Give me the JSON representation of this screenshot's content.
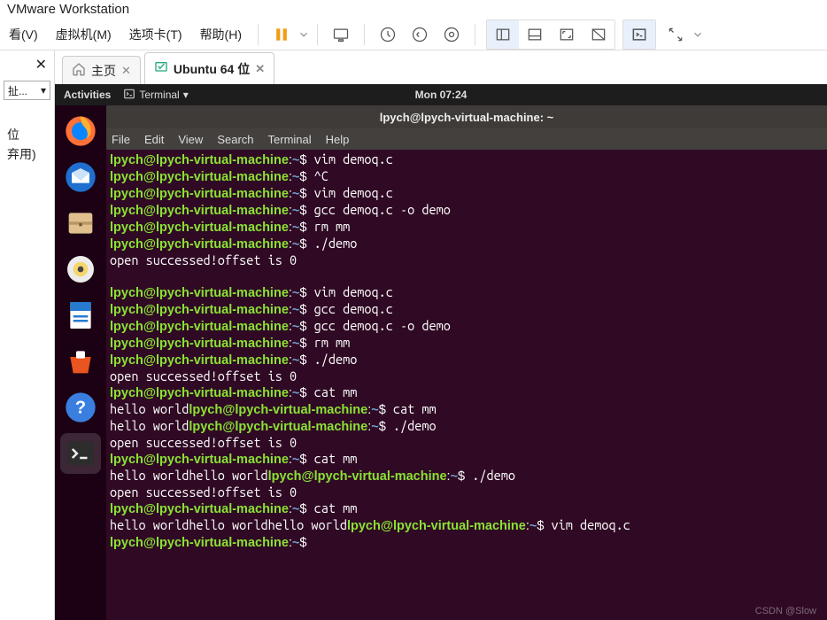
{
  "window": {
    "title": "VMware Workstation"
  },
  "menus": {
    "view": "看(V)",
    "vm": "虚拟机(M)",
    "tabs": "选项卡(T)",
    "help": "帮助(H)"
  },
  "left_panel": {
    "label1": "位",
    "label2": "弃用)",
    "dropdown_label": "扯..."
  },
  "tabs": {
    "home": "主页",
    "vm_tab": "Ubuntu 64 位"
  },
  "gnome": {
    "activities": "Activities",
    "app_label": "Terminal",
    "clock": "Mon 07:24"
  },
  "terminal": {
    "title": "lpych@lpych-virtual-machine: ~",
    "menus": {
      "file": "File",
      "edit": "Edit",
      "view": "View",
      "search": "Search",
      "terminal": "Terminal",
      "help": "Help"
    },
    "prompt_user": "lpych@lpych-virtual-machine",
    "prompt_path": "~",
    "lines": [
      {
        "type": "cmd",
        "text": "vim demoq.c"
      },
      {
        "type": "cmd",
        "text": "^C"
      },
      {
        "type": "cmd",
        "text": "vim demoq.c"
      },
      {
        "type": "cmd",
        "text": "gcc demoq.c -o demo"
      },
      {
        "type": "cmd",
        "text": "rm mm"
      },
      {
        "type": "cmd",
        "text": "./demo"
      },
      {
        "type": "out",
        "text": "open successed!offset is 0"
      },
      {
        "type": "out",
        "text": ""
      },
      {
        "type": "cmd",
        "text": "vim demoq.c"
      },
      {
        "type": "cmd",
        "text": "gcc demoq.c"
      },
      {
        "type": "cmd",
        "text": "gcc demoq.c -o demo"
      },
      {
        "type": "cmd",
        "text": "rm mm"
      },
      {
        "type": "cmd",
        "text": "./demo"
      },
      {
        "type": "out",
        "text": "open successed!offset is 0"
      },
      {
        "type": "cmd",
        "text": "cat mm"
      },
      {
        "type": "inline",
        "pre": "hello world",
        "text": "cat mm"
      },
      {
        "type": "inline",
        "pre": "hello world",
        "text": "./demo"
      },
      {
        "type": "out",
        "text": "open successed!offset is 0"
      },
      {
        "type": "cmd",
        "text": "cat mm"
      },
      {
        "type": "inline",
        "pre": "hello worldhello world",
        "text": "./demo"
      },
      {
        "type": "out",
        "text": "open successed!offset is 0"
      },
      {
        "type": "cmd",
        "text": "cat mm"
      },
      {
        "type": "inline",
        "pre": "hello worldhello worldhello world",
        "text": "vim demoq.c"
      },
      {
        "type": "cmd",
        "text": ""
      }
    ]
  },
  "watermark": "CSDN @Slow"
}
